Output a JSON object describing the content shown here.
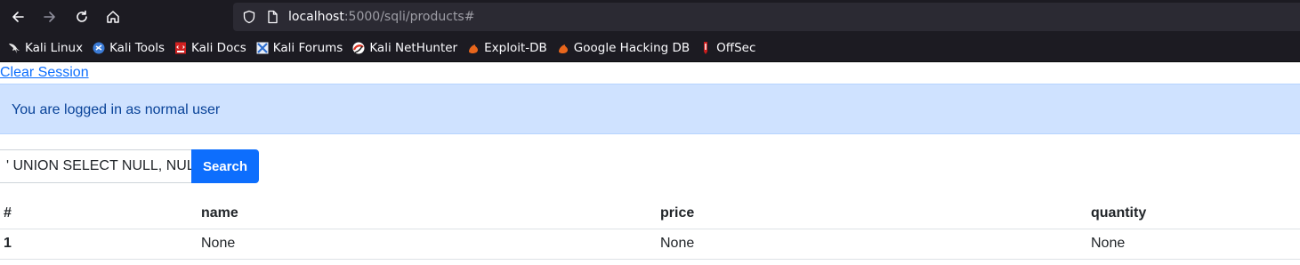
{
  "browser": {
    "url_host": "localhost",
    "url_rest": ":5000/sqli/products#",
    "bookmarks": [
      {
        "label": "Kali Linux",
        "icon": "kali-dragon-icon"
      },
      {
        "label": "Kali Tools",
        "icon": "kali-tools-icon"
      },
      {
        "label": "Kali Docs",
        "icon": "kali-docs-icon"
      },
      {
        "label": "Kali Forums",
        "icon": "kali-forums-icon"
      },
      {
        "label": "Kali NetHunter",
        "icon": "nethunter-icon"
      },
      {
        "label": "Exploit-DB",
        "icon": "exploit-db-icon"
      },
      {
        "label": "Google Hacking DB",
        "icon": "ghdb-icon"
      },
      {
        "label": "OffSec",
        "icon": "offsec-icon"
      }
    ]
  },
  "page": {
    "clear_session_label": "Clear Session",
    "alert_text": "You are logged in as normal user",
    "search": {
      "value": "' UNION SELECT NULL, NULL",
      "button_label": "Search"
    },
    "table": {
      "headers": [
        "#",
        "name",
        "price",
        "quantity"
      ],
      "rows": [
        [
          "1",
          "None",
          "None",
          "None"
        ]
      ]
    }
  },
  "colors": {
    "chrome_bg": "#1c1b22",
    "urlbar_bg": "#2b2a33",
    "link": "#0d6efd",
    "alert_bg": "#cfe2ff",
    "alert_text": "#084298",
    "button_bg": "#0d6efd"
  }
}
